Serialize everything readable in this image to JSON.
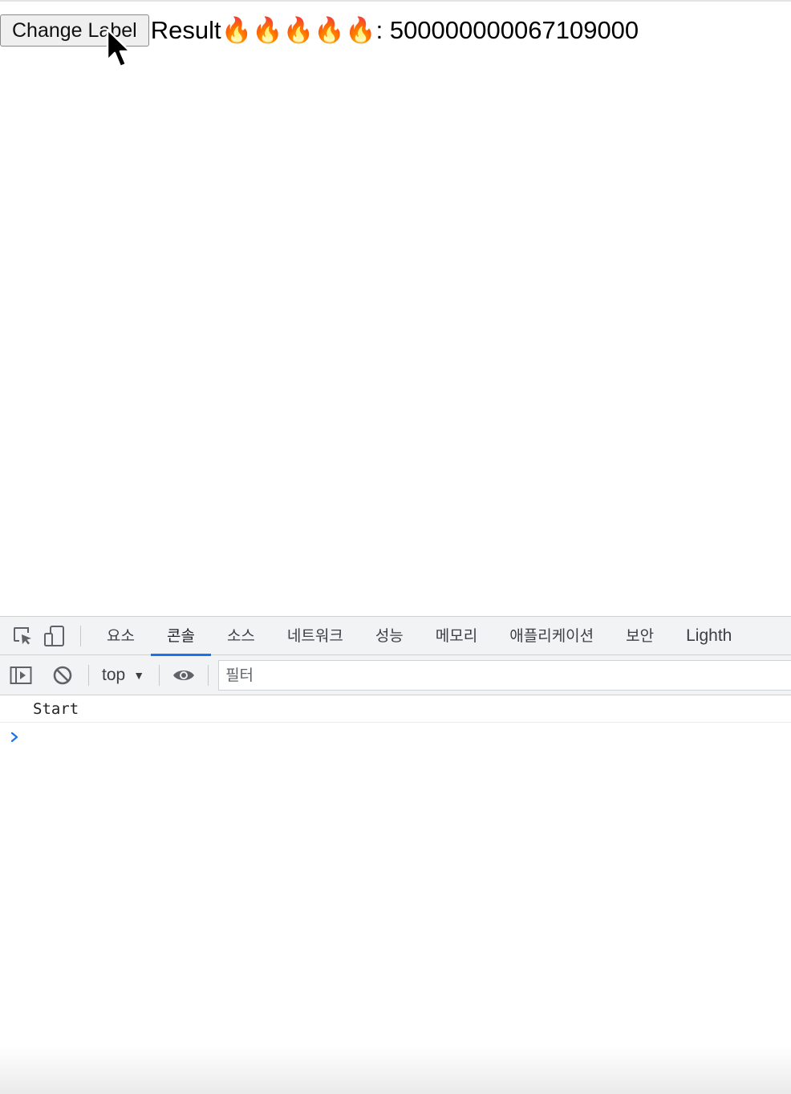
{
  "page": {
    "button_label": "Change Label",
    "result_prefix": "Result",
    "result_emoji": "🔥🔥🔥🔥🔥",
    "result_separator": ":",
    "result_value": "500000000067109000"
  },
  "devtools": {
    "tabs": [
      {
        "label": "요소",
        "active": false
      },
      {
        "label": "콘솔",
        "active": true
      },
      {
        "label": "소스",
        "active": false
      },
      {
        "label": "네트워크",
        "active": false
      },
      {
        "label": "성능",
        "active": false
      },
      {
        "label": "메모리",
        "active": false
      },
      {
        "label": "애플리케이션",
        "active": false
      },
      {
        "label": "보안",
        "active": false
      },
      {
        "label": "Lighth",
        "active": false
      }
    ],
    "toolbar": {
      "context": "top",
      "filter_placeholder": "필터"
    },
    "console": {
      "messages": [
        "Start"
      ],
      "prompt_icon": "chevron-right-icon"
    },
    "icons": {
      "inspect": "inspect-element-icon",
      "device": "device-toolbar-icon",
      "sidebar": "show-sidebar-icon",
      "clear": "clear-console-icon",
      "eye": "live-expression-icon"
    },
    "colors": {
      "active_tab_underline": "#1a73e8",
      "prompt": "#1a73e8",
      "toolbar_bg": "#f1f3f4"
    }
  }
}
